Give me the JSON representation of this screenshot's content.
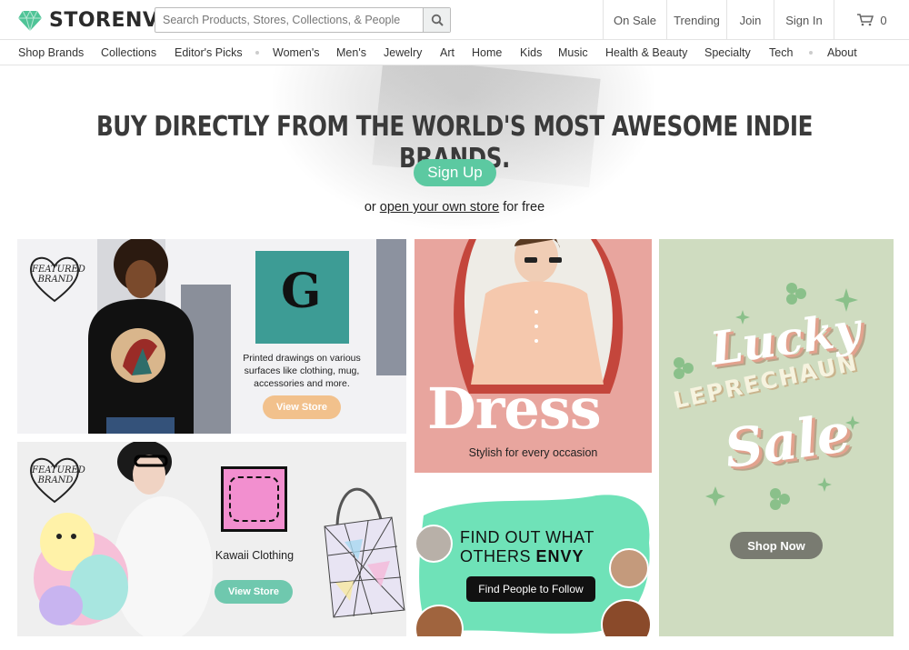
{
  "header": {
    "logo_text": "STORENVY",
    "search_placeholder": "Search Products, Stores, Collections, & People",
    "links": {
      "on_sale": "On Sale",
      "trending": "Trending",
      "join": "Join",
      "sign_in": "Sign In",
      "cart_count": "0"
    }
  },
  "categories": [
    "Shop Brands",
    "Collections",
    "Editor's Picks",
    "Women's",
    "Men's",
    "Jewelry",
    "Art",
    "Home",
    "Kids",
    "Music",
    "Health & Beauty",
    "Specialty",
    "Tech",
    "About"
  ],
  "hero": {
    "title": "BUY DIRECTLY FROM THE WORLD'S MOST AWESOME INDIE BRANDS.",
    "signup": "Sign Up",
    "sub_prefix": "or ",
    "sub_link": "open your own store",
    "sub_suffix": " for free"
  },
  "tiles": {
    "featured1": {
      "badge_line1": "FEATURED",
      "badge_line2": "BRAND",
      "logo_letter": "G",
      "blurb": "Printed drawings on various surfaces like clothing, mug, accessories and more.",
      "button": "View Store"
    },
    "featured2": {
      "badge_line1": "FEATURED",
      "badge_line2": "BRAND",
      "store_name": "Kawaii Clothing",
      "button": "View Store"
    },
    "dress": {
      "title": "Dress",
      "subtitle": "Stylish for every occasion"
    },
    "envy": {
      "line1": "FIND OUT WHAT",
      "line2_prefix": "OTHERS ",
      "line2_bold": "ENVY",
      "button": "Find People to Follow"
    },
    "lucky": {
      "word1": "Lucky",
      "word2": "LEPRECHAUN",
      "word3": "Sale",
      "button": "Shop Now"
    }
  },
  "colors": {
    "brand_green": "#5cc9a1",
    "pill_orange": "#f2c18c",
    "dress_bg": "#e8a59e",
    "lucky_bg": "#cfdcc0",
    "envy_mint": "#6fe2b8"
  }
}
